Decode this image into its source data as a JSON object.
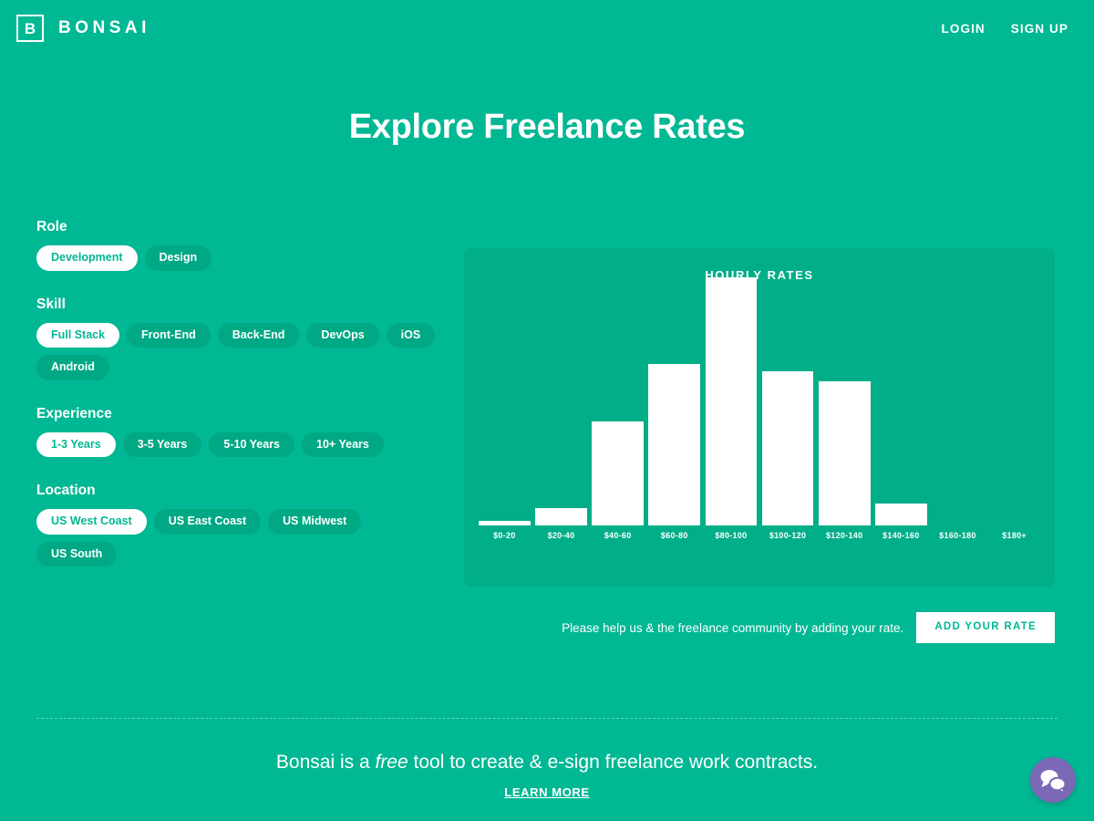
{
  "header": {
    "logo_letter": "B",
    "logo_text": "BONSAI",
    "nav": [
      {
        "label": "LOGIN"
      },
      {
        "label": "SIGN UP"
      }
    ]
  },
  "page_title": "Explore Freelance Rates",
  "filters": [
    {
      "label": "Role",
      "options": [
        {
          "label": "Development",
          "selected": true
        },
        {
          "label": "Design",
          "selected": false
        }
      ]
    },
    {
      "label": "Skill",
      "options": [
        {
          "label": "Full Stack",
          "selected": true
        },
        {
          "label": "Front-End",
          "selected": false
        },
        {
          "label": "Back-End",
          "selected": false
        },
        {
          "label": "DevOps",
          "selected": false
        },
        {
          "label": "iOS",
          "selected": false
        },
        {
          "label": "Android",
          "selected": false
        }
      ]
    },
    {
      "label": "Experience",
      "options": [
        {
          "label": "1-3 Years",
          "selected": true
        },
        {
          "label": "3-5 Years",
          "selected": false
        },
        {
          "label": "5-10 Years",
          "selected": false
        },
        {
          "label": "10+ Years",
          "selected": false
        }
      ]
    },
    {
      "label": "Location",
      "options": [
        {
          "label": "US West Coast",
          "selected": true
        },
        {
          "label": "US East Coast",
          "selected": false
        },
        {
          "label": "US Midwest",
          "selected": false
        },
        {
          "label": "US South",
          "selected": false
        }
      ]
    }
  ],
  "chart_data": {
    "type": "bar",
    "title": "HOURLY RATES",
    "xlabel": "",
    "ylabel": "",
    "grid": false,
    "legend": false,
    "categories": [
      "$0-20",
      "$20-40",
      "$40-60",
      "$60-80",
      "$80-100",
      "$100-120",
      "$120-140",
      "$140-160",
      "$160-180",
      "$180+"
    ],
    "values": [
      2,
      7,
      42,
      65,
      100,
      62,
      58,
      9,
      0,
      0
    ],
    "ylim": [
      0,
      100
    ]
  },
  "cta": {
    "text": "Please help us & the freelance community by adding your rate.",
    "button_label": "ADD YOUR RATE"
  },
  "footer": {
    "text_before": "Bonsai is a ",
    "text_emphasis": "free",
    "text_after": " tool to create & e-sign freelance work contracts.",
    "link_label": "LEARN MORE"
  },
  "chat_widget": {
    "icon": "chat-bubbles-icon",
    "color": "#7b68b6"
  },
  "colors": {
    "brand_green": "#00b894",
    "panel_green": "#00ae88",
    "pill_green": "#00a884",
    "white": "#ffffff",
    "chat_purple": "#7b68b6"
  }
}
